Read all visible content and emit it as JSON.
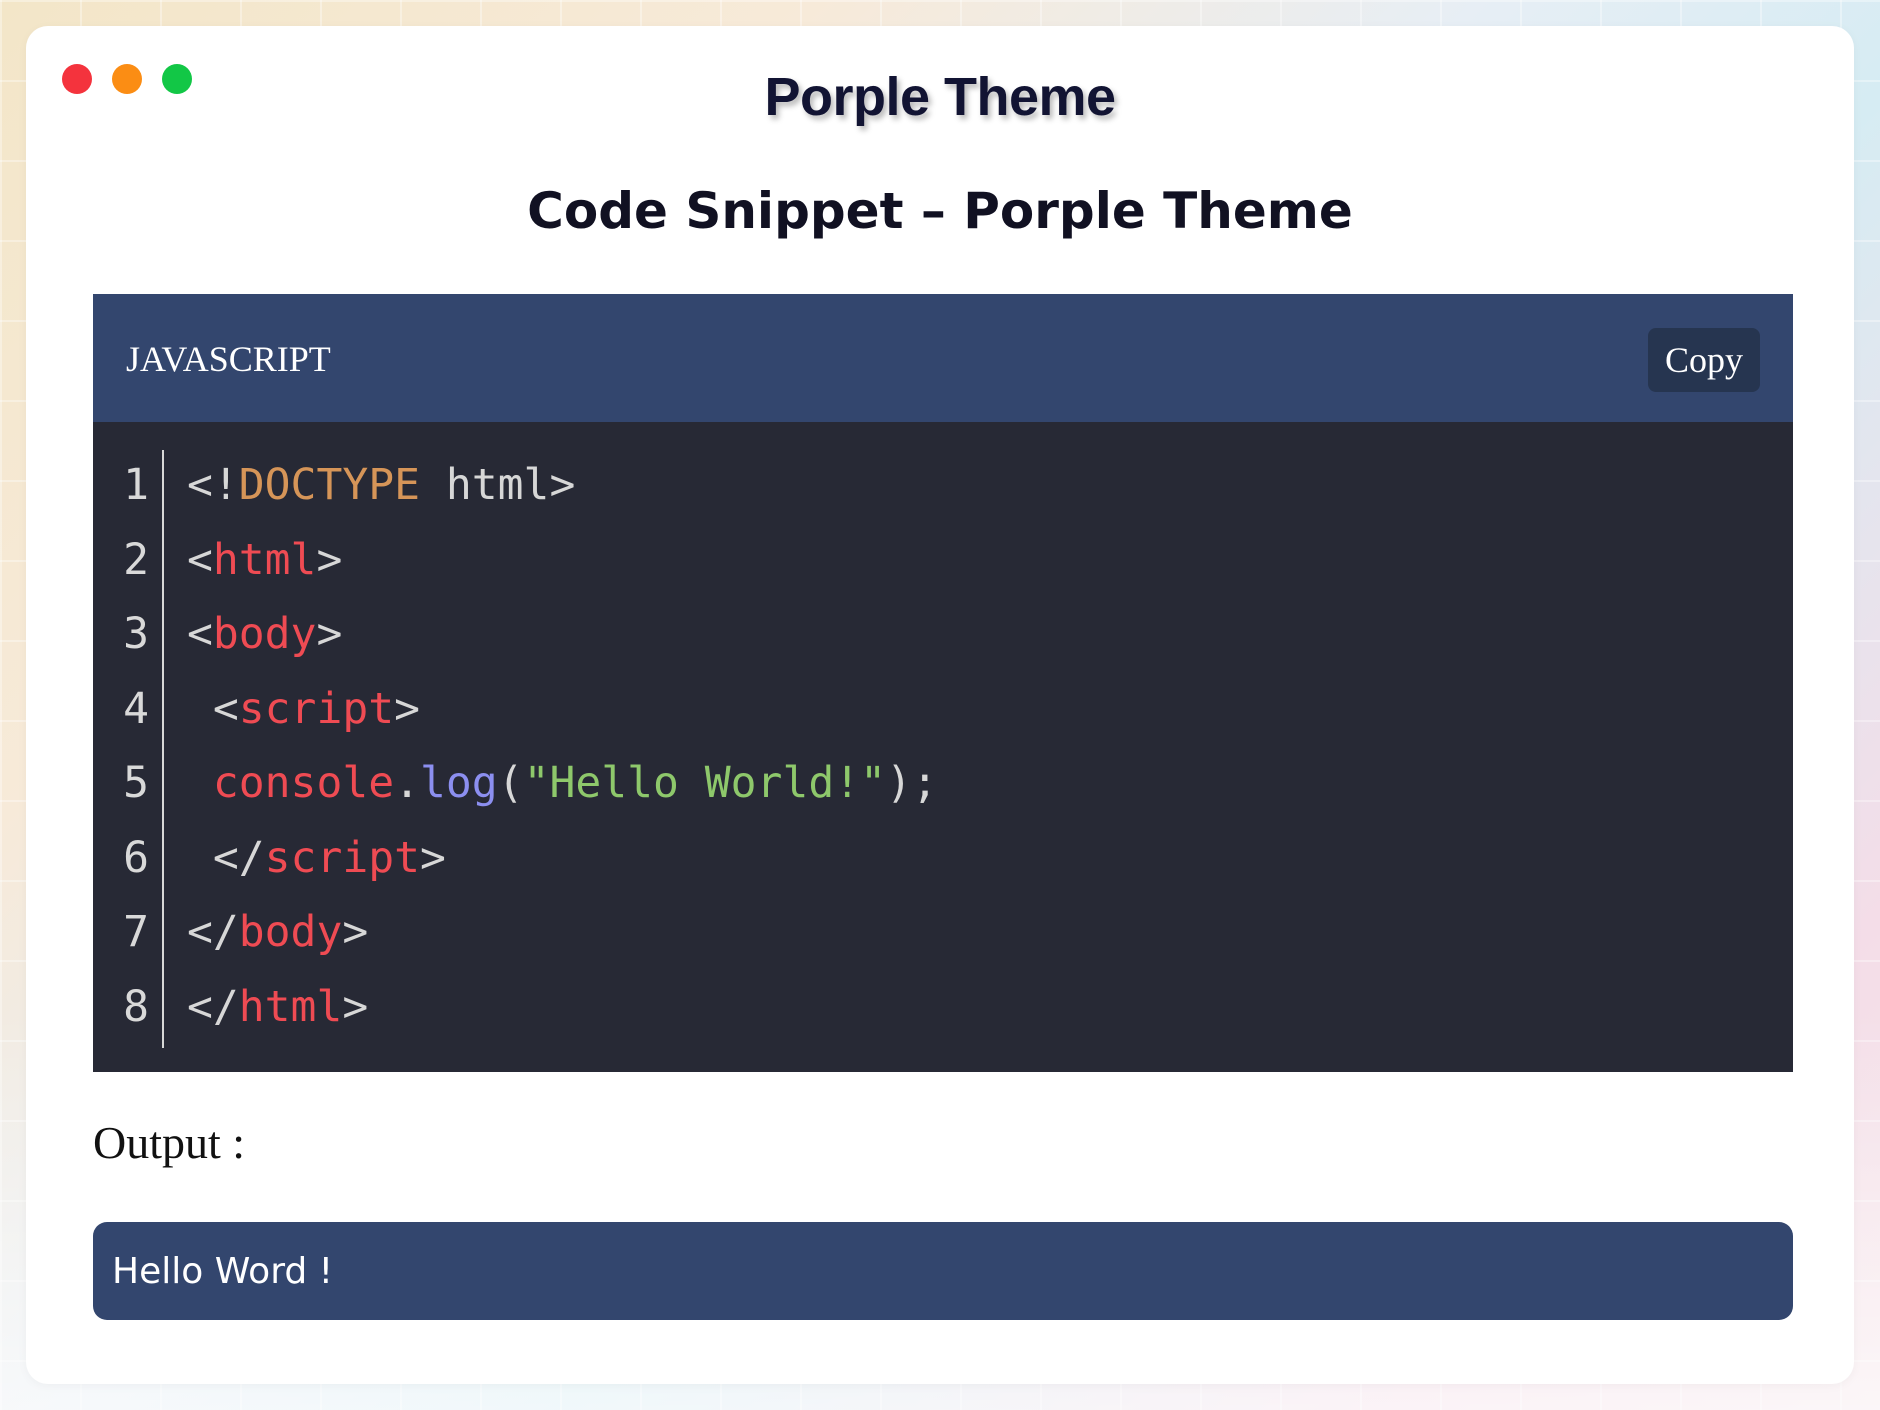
{
  "window": {
    "title": "Porple Theme"
  },
  "page": {
    "heading": "Code Snippet – Porple Theme"
  },
  "code_block": {
    "language": "JAVASCRIPT",
    "copy_label": "Copy",
    "lines": [
      {
        "number": "1",
        "indent": "",
        "tokens": [
          {
            "text": "<!",
            "kind": "punc"
          },
          {
            "text": "DOCTYPE",
            "kind": "doctype"
          },
          {
            "text": " html>",
            "kind": "punc"
          }
        ]
      },
      {
        "number": "2",
        "indent": "",
        "tokens": [
          {
            "text": "<",
            "kind": "punc"
          },
          {
            "text": "html",
            "kind": "tag"
          },
          {
            "text": ">",
            "kind": "punc"
          }
        ]
      },
      {
        "number": "3",
        "indent": "",
        "tokens": [
          {
            "text": "<",
            "kind": "punc"
          },
          {
            "text": "body",
            "kind": "tag"
          },
          {
            "text": ">",
            "kind": "punc"
          }
        ]
      },
      {
        "number": "4",
        "indent": " ",
        "tokens": [
          {
            "text": "<",
            "kind": "punc"
          },
          {
            "text": "script",
            "kind": "tag"
          },
          {
            "text": ">",
            "kind": "punc"
          }
        ]
      },
      {
        "number": "5",
        "indent": " ",
        "tokens": [
          {
            "text": "console",
            "kind": "ident"
          },
          {
            "text": ".",
            "kind": "punc"
          },
          {
            "text": "log",
            "kind": "method"
          },
          {
            "text": "(",
            "kind": "punc"
          },
          {
            "text": "\"Hello World!\"",
            "kind": "str"
          },
          {
            "text": ");",
            "kind": "punc"
          }
        ]
      },
      {
        "number": "6",
        "indent": " ",
        "tokens": [
          {
            "text": "</",
            "kind": "punc"
          },
          {
            "text": "script",
            "kind": "tag"
          },
          {
            "text": ">",
            "kind": "punc"
          }
        ]
      },
      {
        "number": "7",
        "indent": "",
        "tokens": [
          {
            "text": "</",
            "kind": "punc"
          },
          {
            "text": "body",
            "kind": "tag"
          },
          {
            "text": ">",
            "kind": "punc"
          }
        ]
      },
      {
        "number": "8",
        "indent": "",
        "tokens": [
          {
            "text": "</",
            "kind": "punc"
          },
          {
            "text": "html",
            "kind": "tag"
          },
          {
            "text": ">",
            "kind": "punc"
          }
        ]
      }
    ]
  },
  "output": {
    "label": "Output :",
    "value": "Hello Word !"
  },
  "colors": {
    "header_bg": "#33466e",
    "code_bg": "#272935",
    "tag": "#ef4b53",
    "doctype": "#d69558",
    "method": "#8c8ff0",
    "string": "#8ec86b",
    "close_dot": "#f4333d",
    "minimize_dot": "#fb8d14",
    "maximize_dot": "#12c746"
  },
  "icons": {
    "window_controls": [
      "close-dot-icon",
      "minimize-dot-icon",
      "maximize-dot-icon"
    ]
  }
}
